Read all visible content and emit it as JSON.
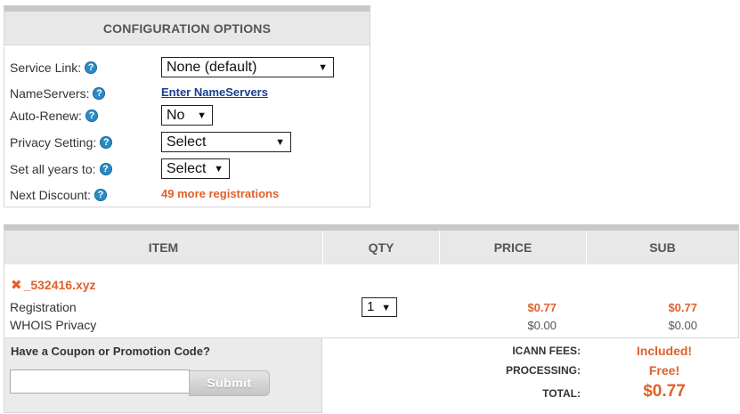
{
  "config": {
    "title": "CONFIGURATION OPTIONS",
    "rows": [
      {
        "label": "Service Link:",
        "value": "None (default)"
      },
      {
        "label": "NameServers:",
        "value": "Enter NameServers"
      },
      {
        "label": "Auto-Renew:",
        "value": "No"
      },
      {
        "label": "Privacy Setting:",
        "value": "Select"
      },
      {
        "label": "Set all years to:",
        "value": "Select"
      },
      {
        "label": "Next Discount:",
        "value": "49 more registrations"
      }
    ],
    "help_glyph": "?"
  },
  "cart": {
    "columns": [
      "ITEM",
      "QTY",
      "PRICE",
      "SUB"
    ],
    "remove_glyph": "✖",
    "domain": "_532416.xyz",
    "lines": [
      {
        "label": "Registration",
        "qty": "1",
        "price": "$0.77",
        "sub": "$0.77"
      },
      {
        "label": "WHOIS Privacy",
        "price": "$0.00",
        "sub": "$0.00"
      }
    ]
  },
  "coupon": {
    "title": "Have a Coupon or Promotion Code?",
    "input_value": "",
    "button_label": "Submit"
  },
  "totals": {
    "icann_label": "ICANN FEES:",
    "icann_value": "Included!",
    "processing_label": "PROCESSING:",
    "processing_value": "Free!",
    "total_label": "TOTAL:",
    "total_value": "$0.77"
  },
  "icons": {
    "help": "help-icon",
    "remove": "remove-icon",
    "dropdown": "chevron-down-icon"
  },
  "colors": {
    "accent": "#e0602a",
    "help_blue": "#2a8ac4",
    "link": "#1a3d8f",
    "header_gray": "#e8e8e8"
  }
}
